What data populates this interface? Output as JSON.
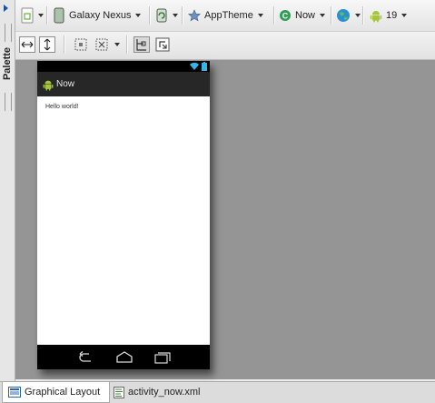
{
  "palette": {
    "label": "Palette"
  },
  "toolbar": {
    "device_label": "Galaxy Nexus",
    "theme_label": "AppTheme",
    "activity_label": "Now",
    "api_level": "19"
  },
  "device": {
    "app_title": "Now",
    "hello_text": "Hello world!"
  },
  "tabs": {
    "graphical_layout": "Graphical Layout",
    "xml_file": "activity_now.xml"
  },
  "colors": {
    "canvas": "#959595",
    "action_bar": "#272727",
    "android_green": "#a4c639",
    "wifi_blue": "#33b5e5"
  }
}
